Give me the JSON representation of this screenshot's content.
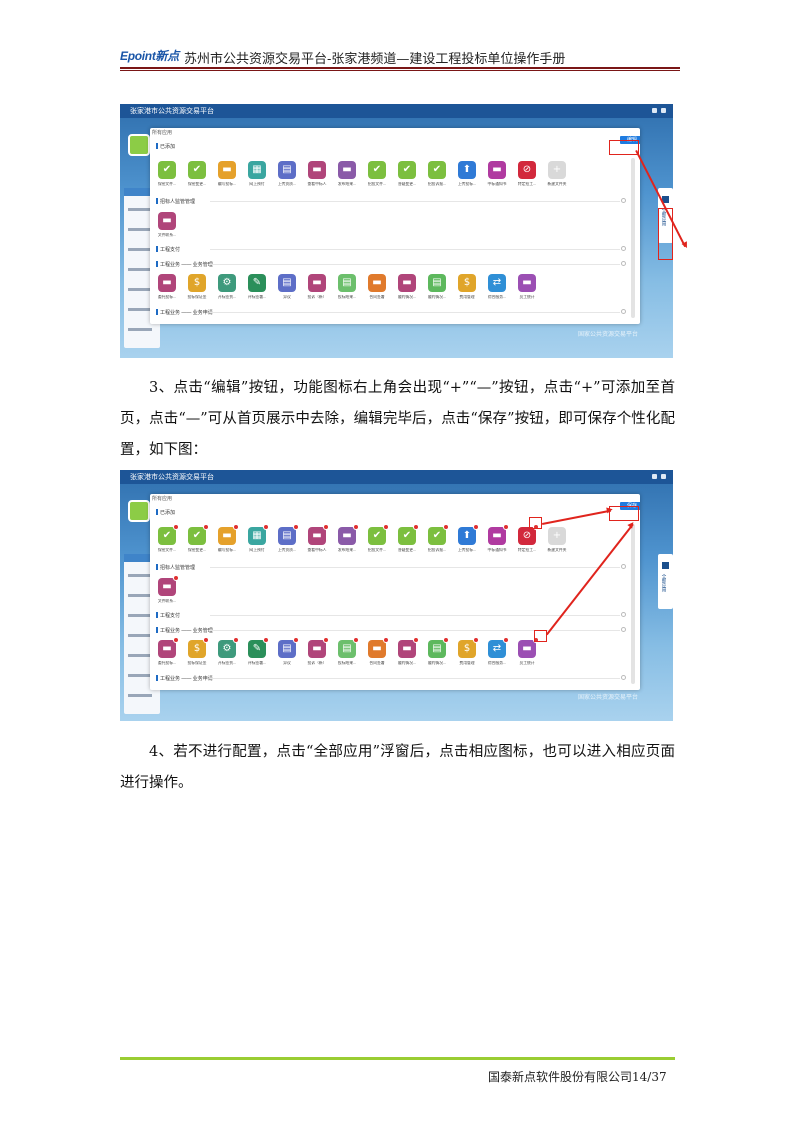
{
  "header": {
    "logo_text": "Epoint新点",
    "title": "苏州市公共资源交易平台-张家港频道—建设工程投标单位操作手册"
  },
  "screenshots": [
    {
      "app_title": "张家港市公共资源交易平台",
      "dialog_header": "所有应用",
      "sections": {
        "added": "已添加",
        "review": "招标人监管管理",
        "payment": "工程支付",
        "business": "工程业务 —— 业务管理",
        "apply": "工程业务 —— 业务申请"
      },
      "button_label": "编辑",
      "side_tab_label": "全部应用"
    },
    {
      "app_title": "张家港市公共资源交易平台",
      "dialog_header": "所有应用",
      "sections": {
        "added": "已添加",
        "review": "招标人监管管理",
        "payment": "工程支付",
        "business": "工程业务 —— 业务管理",
        "apply": "工程业务 —— 业务申请"
      },
      "button_label": "保存",
      "side_tab_label": "全部应用"
    }
  ],
  "row1_labels": [
    "保密文件...",
    "保密变更...",
    "编写投标...",
    "网上预付",
    "上传资质...",
    "查看中标人",
    "发布结果...",
    "招投文件...",
    "答疑变更...",
    "招投诉报...",
    "上传投标...",
    "中标通知书",
    "特定招工...",
    "新建文件夹"
  ],
  "row2_labels": [
    "文件联系..."
  ],
  "row3_labels": [
    "委托投标...",
    "投标保证金",
    "开标签到...",
    "评标签署...",
    "异议",
    "投诉（新）",
    "投标结果...",
    "合同签署",
    "履约情况...",
    "履约情况...",
    "费用管理",
    "综合服务...",
    "员工统计"
  ],
  "wm_text": "国家公共资源交易平台",
  "paragraph1": "3、点击“编辑”按钮，功能图标右上角会出现“+”“—”按钮，点击“+”可添加至首页，点击“—”可从首页展示中去除，编辑完毕后，点击“保存”按钮，即可保存个性化配置，如下图：",
  "paragraph2": "4、若不进行配置，点击“全部应用”浮窗后，点击相应图标，也可以进入相应页面进行操作。",
  "footer": {
    "company": "国泰新点软件股份有限公司",
    "page": "14",
    "total": "/37"
  },
  "colors": {
    "accent_red": "#e0241d",
    "brand_blue": "#1d5597",
    "footer_green": "#9acd32",
    "header_rule": "#7a1616"
  }
}
